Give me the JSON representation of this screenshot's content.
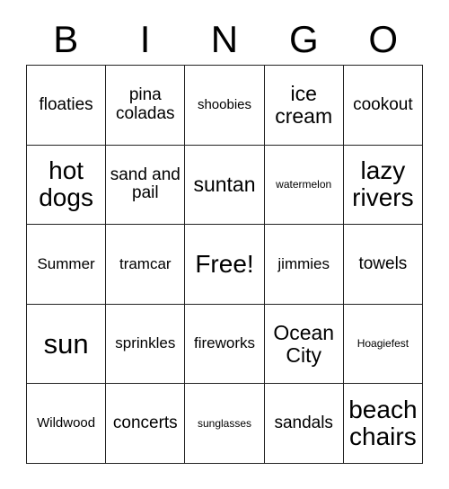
{
  "card": {
    "title_letters": [
      "B",
      "I",
      "N",
      "G",
      "O"
    ],
    "border_color": "#222222",
    "text_color": "#000000",
    "background_color": "#ffffff"
  },
  "grid": {
    "columns": 5,
    "rows": 5,
    "free_space": {
      "row": 3,
      "column": 3,
      "label": "Free!"
    },
    "cells": [
      {
        "text": "floaties",
        "size": "lg"
      },
      {
        "text": "pina coladas",
        "size": "lg"
      },
      {
        "text": "shoobies",
        "size": "sm"
      },
      {
        "text": "ice cream",
        "size": "xl"
      },
      {
        "text": "cookout",
        "size": "lg"
      },
      {
        "text": "hot dogs",
        "size": "xxl"
      },
      {
        "text": "sand and pail",
        "size": "lg"
      },
      {
        "text": "suntan",
        "size": "xl"
      },
      {
        "text": "watermelon",
        "size": "xs"
      },
      {
        "text": "lazy rivers",
        "size": "xxl"
      },
      {
        "text": "Summer",
        "size": "md"
      },
      {
        "text": "tramcar",
        "size": "md"
      },
      {
        "text": "Free!",
        "size": "xxl"
      },
      {
        "text": "jimmies",
        "size": "md"
      },
      {
        "text": "towels",
        "size": "lg"
      },
      {
        "text": "sun",
        "size": "huge"
      },
      {
        "text": "sprinkles",
        "size": "md"
      },
      {
        "text": "fireworks",
        "size": "md"
      },
      {
        "text": "Ocean City",
        "size": "xl"
      },
      {
        "text": "Hoagiefest",
        "size": "xs"
      },
      {
        "text": "Wildwood",
        "size": "sm"
      },
      {
        "text": "concerts",
        "size": "lg"
      },
      {
        "text": "sunglasses",
        "size": "xs"
      },
      {
        "text": "sandals",
        "size": "lg"
      },
      {
        "text": "beach chairs",
        "size": "xxl"
      }
    ]
  }
}
